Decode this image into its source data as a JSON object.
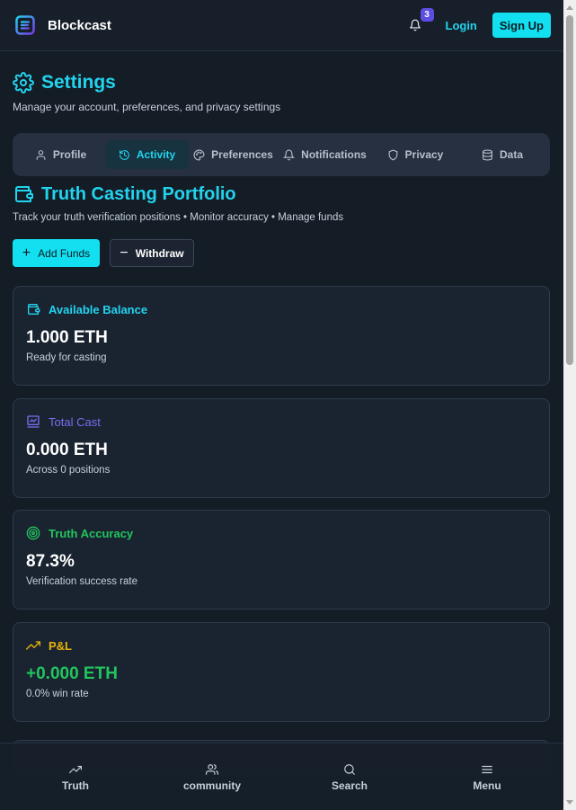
{
  "header": {
    "brand": "Blockcast",
    "notification_count": "3",
    "login_label": "Login",
    "signup_label": "Sign Up"
  },
  "settings": {
    "title": "Settings",
    "subtitle": "Manage your account, preferences, and privacy settings"
  },
  "tabs": [
    {
      "label": "Profile",
      "icon": "user-icon"
    },
    {
      "label": "Activity",
      "icon": "history-icon",
      "active": true
    },
    {
      "label": "Preferences",
      "icon": "palette-icon"
    },
    {
      "label": "Notifications",
      "icon": "bell-icon"
    },
    {
      "label": "Privacy",
      "icon": "shield-icon"
    },
    {
      "label": "Data",
      "icon": "database-icon"
    }
  ],
  "portfolio": {
    "title": "Truth Casting Portfolio",
    "subtitle": "Track your truth verification positions • Monitor accuracy • Manage funds",
    "add_funds_label": "Add Funds",
    "withdraw_label": "Withdraw"
  },
  "cards": [
    {
      "title": "Available Balance",
      "value": "1.000 ETH",
      "desc": "Ready for casting",
      "icon": "wallet-icon",
      "accent": "#22d3ee"
    },
    {
      "title": "Total Cast",
      "value": "0.000 ETH",
      "desc": "Across 0 positions",
      "icon": "chart-box-icon",
      "accent": "#7c6cf0"
    },
    {
      "title": "Truth Accuracy",
      "value": "87.3%",
      "desc": "Verification success rate",
      "icon": "target-icon",
      "accent": "#22c55e"
    },
    {
      "title": "P&L",
      "value": "+0.000 ETH",
      "desc": "0.0% win rate",
      "icon": "trending-up-icon",
      "accent": "#eab308",
      "value_color": "#22c55e"
    }
  ],
  "bottom_nav": [
    {
      "label": "Truth",
      "icon": "trending-up-icon"
    },
    {
      "label": "community",
      "icon": "users-icon"
    },
    {
      "label": "Search",
      "icon": "search-icon"
    },
    {
      "label": "Menu",
      "icon": "menu-icon"
    }
  ]
}
